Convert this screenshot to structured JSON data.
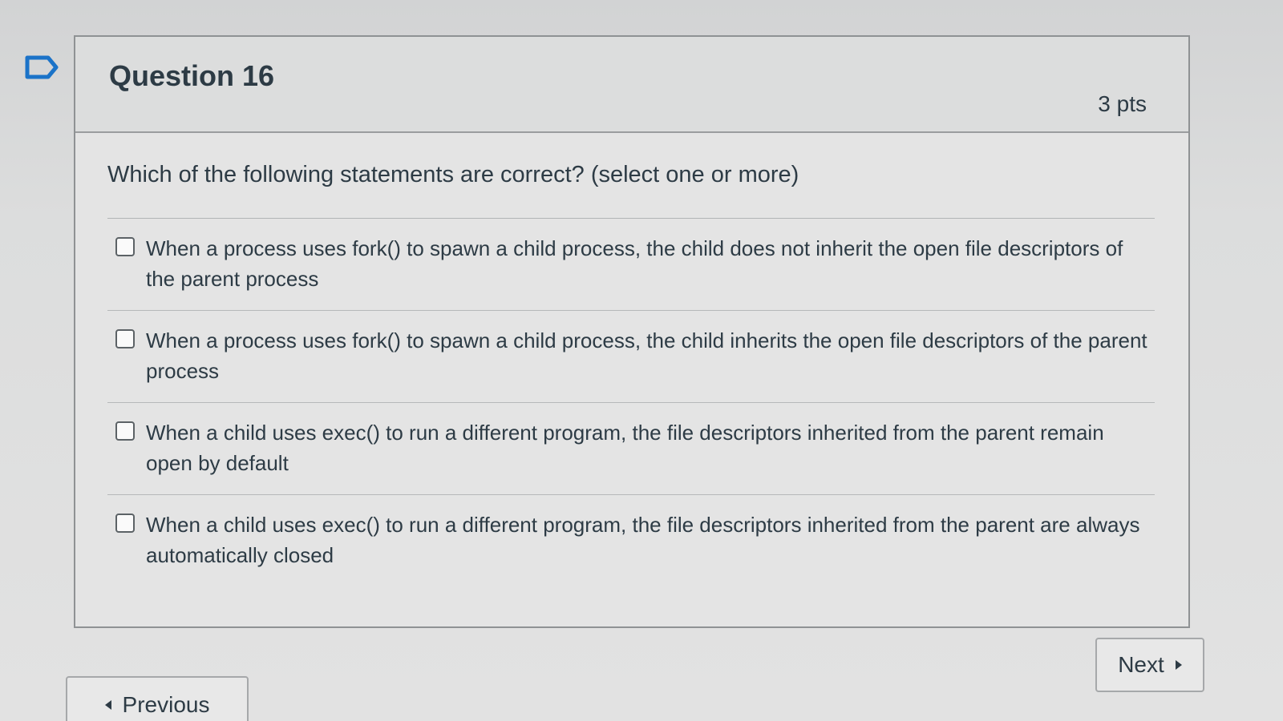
{
  "question": {
    "title": "Question 16",
    "points": "3 pts",
    "prompt": "Which of the following statements are correct? (select one or more)",
    "answers": [
      {
        "text": "When a process uses fork() to spawn a child process, the child does not inherit the open file descriptors of the parent process",
        "checked": false
      },
      {
        "text": "When a process uses fork() to spawn a child process, the child inherits the open file descriptors of the parent process",
        "checked": false
      },
      {
        "text": "When a child uses exec() to run a different program, the file descriptors inherited from the parent remain open by default",
        "checked": false
      },
      {
        "text": "When a child uses exec() to run a different program, the file descriptors inherited from the parent are always automatically closed",
        "checked": false
      }
    ]
  },
  "navigation": {
    "next_label": "Next",
    "previous_label": "Previous"
  },
  "icons": {
    "flag": "bookmark-flag-icon",
    "next": "caret-right-icon",
    "previous": "caret-left-icon"
  },
  "colors": {
    "text": "#2d3b45",
    "border": "#8f9294",
    "card": "#e4e4e4"
  }
}
